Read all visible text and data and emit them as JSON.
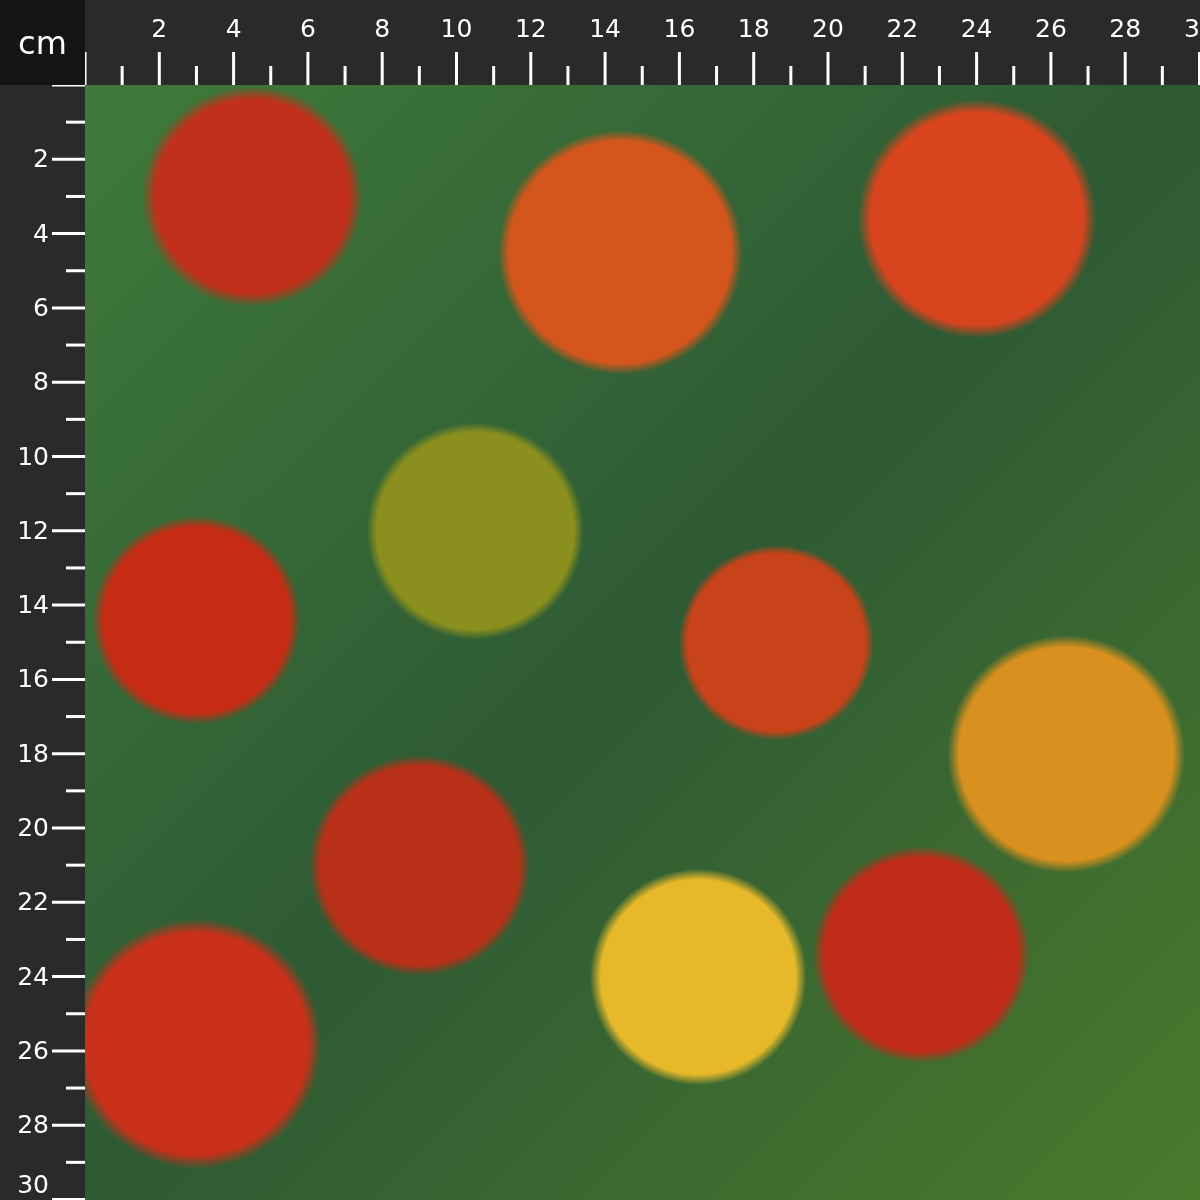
{
  "unit_label": "cm",
  "top_ruler": {
    "labels": [
      "2",
      "4",
      "6",
      "8",
      "10",
      "12",
      "14",
      "16",
      "18",
      "20",
      "22",
      "24",
      "26",
      "28",
      "3"
    ]
  },
  "left_ruler": {
    "labels": [
      "2",
      "4",
      "6",
      "8",
      "10",
      "12",
      "14",
      "16",
      "18",
      "20",
      "22",
      "24",
      "26",
      "28",
      "30"
    ]
  }
}
